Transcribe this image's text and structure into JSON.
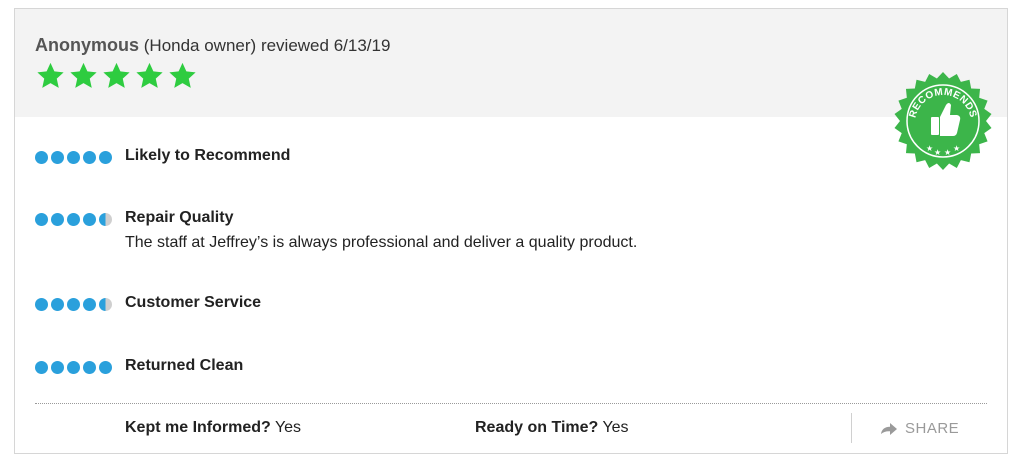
{
  "review": {
    "reviewer": "Anonymous",
    "owner_note": "(Honda owner)",
    "reviewed_text": "reviewed 6/13/19",
    "star_rating": 5,
    "star_color": "#2ecc40",
    "badge": {
      "text": "RECOMMENDS",
      "icon": "thumbs-up-icon",
      "color": "#3cb54a"
    }
  },
  "ratings": [
    {
      "label": "Likely to Recommend",
      "score": 5,
      "comment": ""
    },
    {
      "label": "Repair Quality",
      "score": 4.5,
      "comment": "The staff at Jeffrey’s is always professional and deliver a quality product."
    },
    {
      "label": "Customer Service",
      "score": 4.5,
      "comment": ""
    },
    {
      "label": "Returned Clean",
      "score": 5,
      "comment": ""
    }
  ],
  "footer": {
    "kept_informed_label": "Kept me Informed?",
    "kept_informed_value": "Yes",
    "ready_on_time_label": "Ready on Time?",
    "ready_on_time_value": "Yes",
    "share_label": "SHARE"
  },
  "colors": {
    "dot": "#2aa0dc",
    "dot_empty": "#cfcfcf"
  }
}
